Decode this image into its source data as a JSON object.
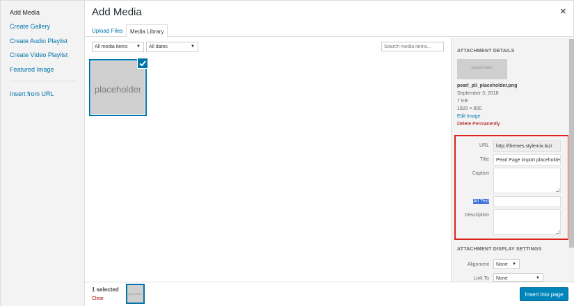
{
  "menu": {
    "items": [
      {
        "label": "Add Media"
      },
      {
        "label": "Create Gallery"
      },
      {
        "label": "Create Audio Playlist"
      },
      {
        "label": "Create Video Playlist"
      },
      {
        "label": "Featured Image"
      },
      {
        "label": "Insert from URL"
      }
    ]
  },
  "modal": {
    "title": "Add Media",
    "close_icon": "close-icon"
  },
  "tabs": [
    {
      "label": "Upload Files"
    },
    {
      "label": "Media Library"
    }
  ],
  "toolbar": {
    "media_filter": "All media items",
    "date_filter": "All dates",
    "search_placeholder": "Search media items..."
  },
  "grid": {
    "items": [
      {
        "label": "placeholder",
        "selected": true
      }
    ]
  },
  "details": {
    "heading": "ATTACHMENT DETAILS",
    "preview_label": "placeholder",
    "filename": "pearl_pli_placeholder.png",
    "date": "September 3, 2018",
    "size": "7 KB",
    "dimensions": "1920 × 800",
    "edit_link": "Edit Image",
    "delete_link": "Delete Permanently",
    "fields": {
      "url_label": "URL",
      "url_value": "http://themes.stylemix.biz/",
      "title_label": "Title",
      "title_value": "Pearl Page import placeholder",
      "caption_label": "Caption",
      "alt_label": "Alt Text",
      "description_label": "Description"
    }
  },
  "display_settings": {
    "heading": "ATTACHMENT DISPLAY SETTINGS",
    "alignment_label": "Alignment",
    "alignment_value": "None",
    "linkto_label": "Link To",
    "linkto_value": "None"
  },
  "footer": {
    "selected_text": "1 selected",
    "clear_label": "Clear",
    "mini_thumb_label": "placeholder",
    "insert_button": "Insert into page"
  },
  "colors": {
    "accent": "#0073aa",
    "highlight": "#d9231b",
    "danger": "#a00000"
  }
}
